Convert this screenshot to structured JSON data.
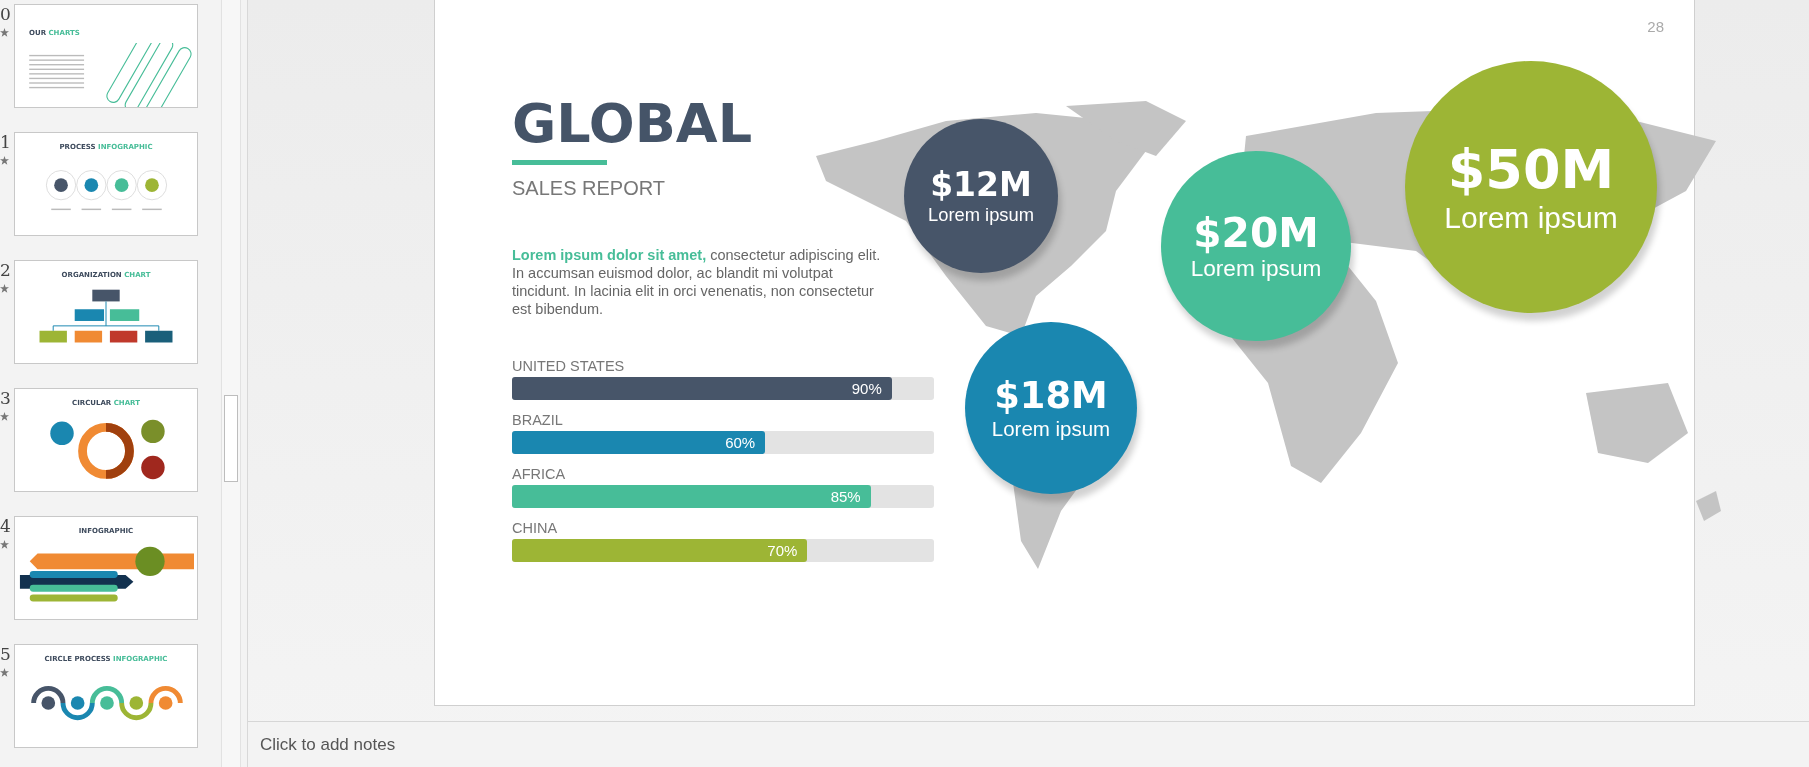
{
  "thumbnails": [
    {
      "number": "0",
      "starred": true,
      "title": "OUR *CHARTS*",
      "kind": "text",
      "selected": false
    },
    {
      "number": "1",
      "starred": true,
      "title": "PROCESS *INFOGRAPHIC*",
      "kind": "process",
      "selected": false
    },
    {
      "number": "2",
      "starred": true,
      "title": "ORGANIZATION *CHART*",
      "kind": "org",
      "selected": false
    },
    {
      "number": "3",
      "starred": true,
      "title": "CIRCULAR *CHART*",
      "kind": "circular",
      "selected": false
    },
    {
      "number": "4",
      "starred": true,
      "title": "INFOGRAPHIC",
      "kind": "arrows",
      "selected": false
    },
    {
      "number": "5",
      "starred": true,
      "title": "CIRCLE PROCESS *INFOGRAPHIC*",
      "kind": "wave",
      "selected": false
    }
  ],
  "slide": {
    "page_number": "28",
    "title": "GLOBAL",
    "subtitle": "SALES REPORT",
    "paragraph": "**Lorem ipsum dolor sit amet,** consectetur adipiscing elit. In accumsan euismod dolor, ac blandit mi volutpat tincidunt. In lacinia elit in orci venenatis, non consectetur est bibendum.",
    "bars": [
      {
        "label": "UNITED STATES",
        "value": "90%",
        "level": 0.9,
        "color": "#475569"
      },
      {
        "label": "BRAZIL",
        "value": "60%",
        "level": 0.6,
        "color": "#1a87b0"
      },
      {
        "label": "AFRICA",
        "value": "85%",
        "level": 0.85,
        "color": "#47bd98"
      },
      {
        "label": "CHINA",
        "value": "70%",
        "level": 0.7,
        "color": "#9db535"
      }
    ],
    "bubbles": [
      {
        "amount": "$12M",
        "caption": "Lorem ipsum",
        "color": "#475569"
      },
      {
        "amount": "$18M",
        "caption": "Lorem ipsum",
        "color": "#1a87b0"
      },
      {
        "amount": "$20M",
        "caption": "Lorem ipsum",
        "color": "#47bd98"
      },
      {
        "amount": "$50M",
        "caption": "Lorem ipsum",
        "color": "#9db535"
      }
    ]
  },
  "notes": {
    "placeholder": "Click to add notes"
  }
}
